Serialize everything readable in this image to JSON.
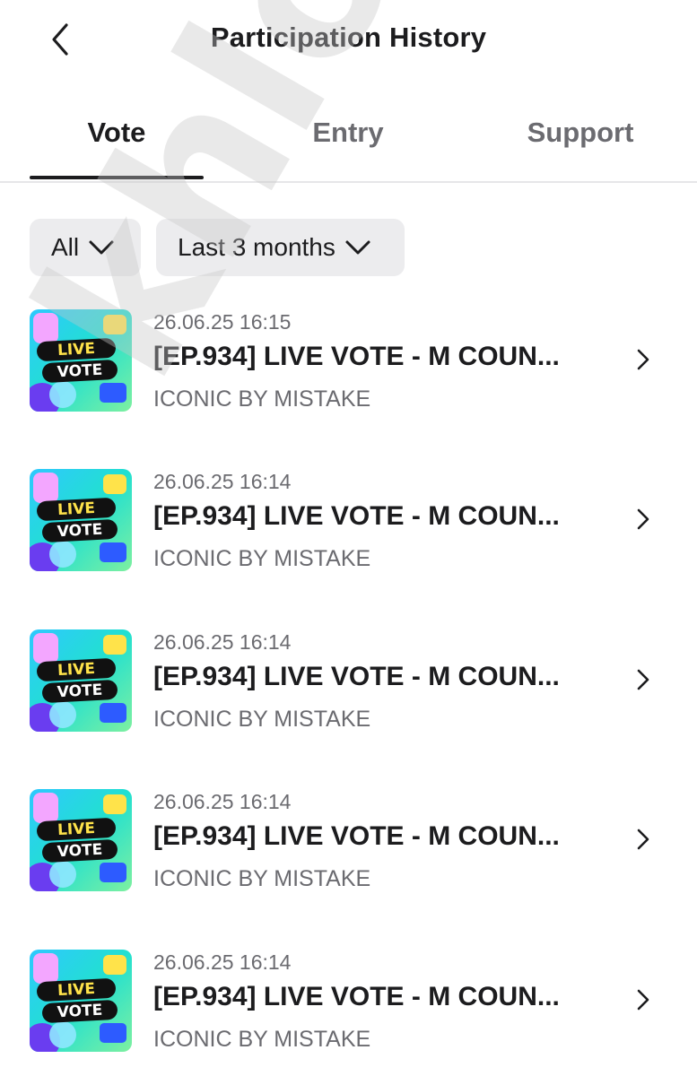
{
  "header": {
    "title": "Participation History"
  },
  "tabs": [
    {
      "label": "Vote",
      "active": true
    },
    {
      "label": "Entry",
      "active": false
    },
    {
      "label": "Support",
      "active": false
    }
  ],
  "filters": {
    "type": "All",
    "period": "Last 3 months"
  },
  "items": [
    {
      "date": "26.06.25 16:15",
      "title": "[EP.934] LIVE VOTE - M COUN...",
      "artist": "ICONIC BY MISTAKE",
      "thumb_line1": "LIVE",
      "thumb_line2": "VOTE"
    },
    {
      "date": "26.06.25 16:14",
      "title": "[EP.934] LIVE VOTE - M COUN...",
      "artist": "ICONIC BY MISTAKE",
      "thumb_line1": "LIVE",
      "thumb_line2": "VOTE"
    },
    {
      "date": "26.06.25 16:14",
      "title": "[EP.934] LIVE VOTE - M COUN...",
      "artist": "ICONIC BY MISTAKE",
      "thumb_line1": "LIVE",
      "thumb_line2": "VOTE"
    },
    {
      "date": "26.06.25 16:14",
      "title": "[EP.934] LIVE VOTE - M COUN...",
      "artist": "ICONIC BY MISTAKE",
      "thumb_line1": "LIVE",
      "thumb_line2": "VOTE"
    },
    {
      "date": "26.06.25 16:14",
      "title": "[EP.934] LIVE VOTE - M COUN...",
      "artist": "ICONIC BY MISTAKE",
      "thumb_line1": "LIVE",
      "thumb_line2": "VOTE"
    }
  ],
  "watermark": {
    "text": "khloha"
  },
  "icons": {
    "back": "chevron-left-icon",
    "dropdown": "chevron-down-icon",
    "row": "chevron-right-icon"
  },
  "colors": {
    "text_primary": "#1c1c1e",
    "text_secondary": "#6b6b70",
    "filter_bg": "#ececee",
    "divider": "#e6e6e8"
  }
}
